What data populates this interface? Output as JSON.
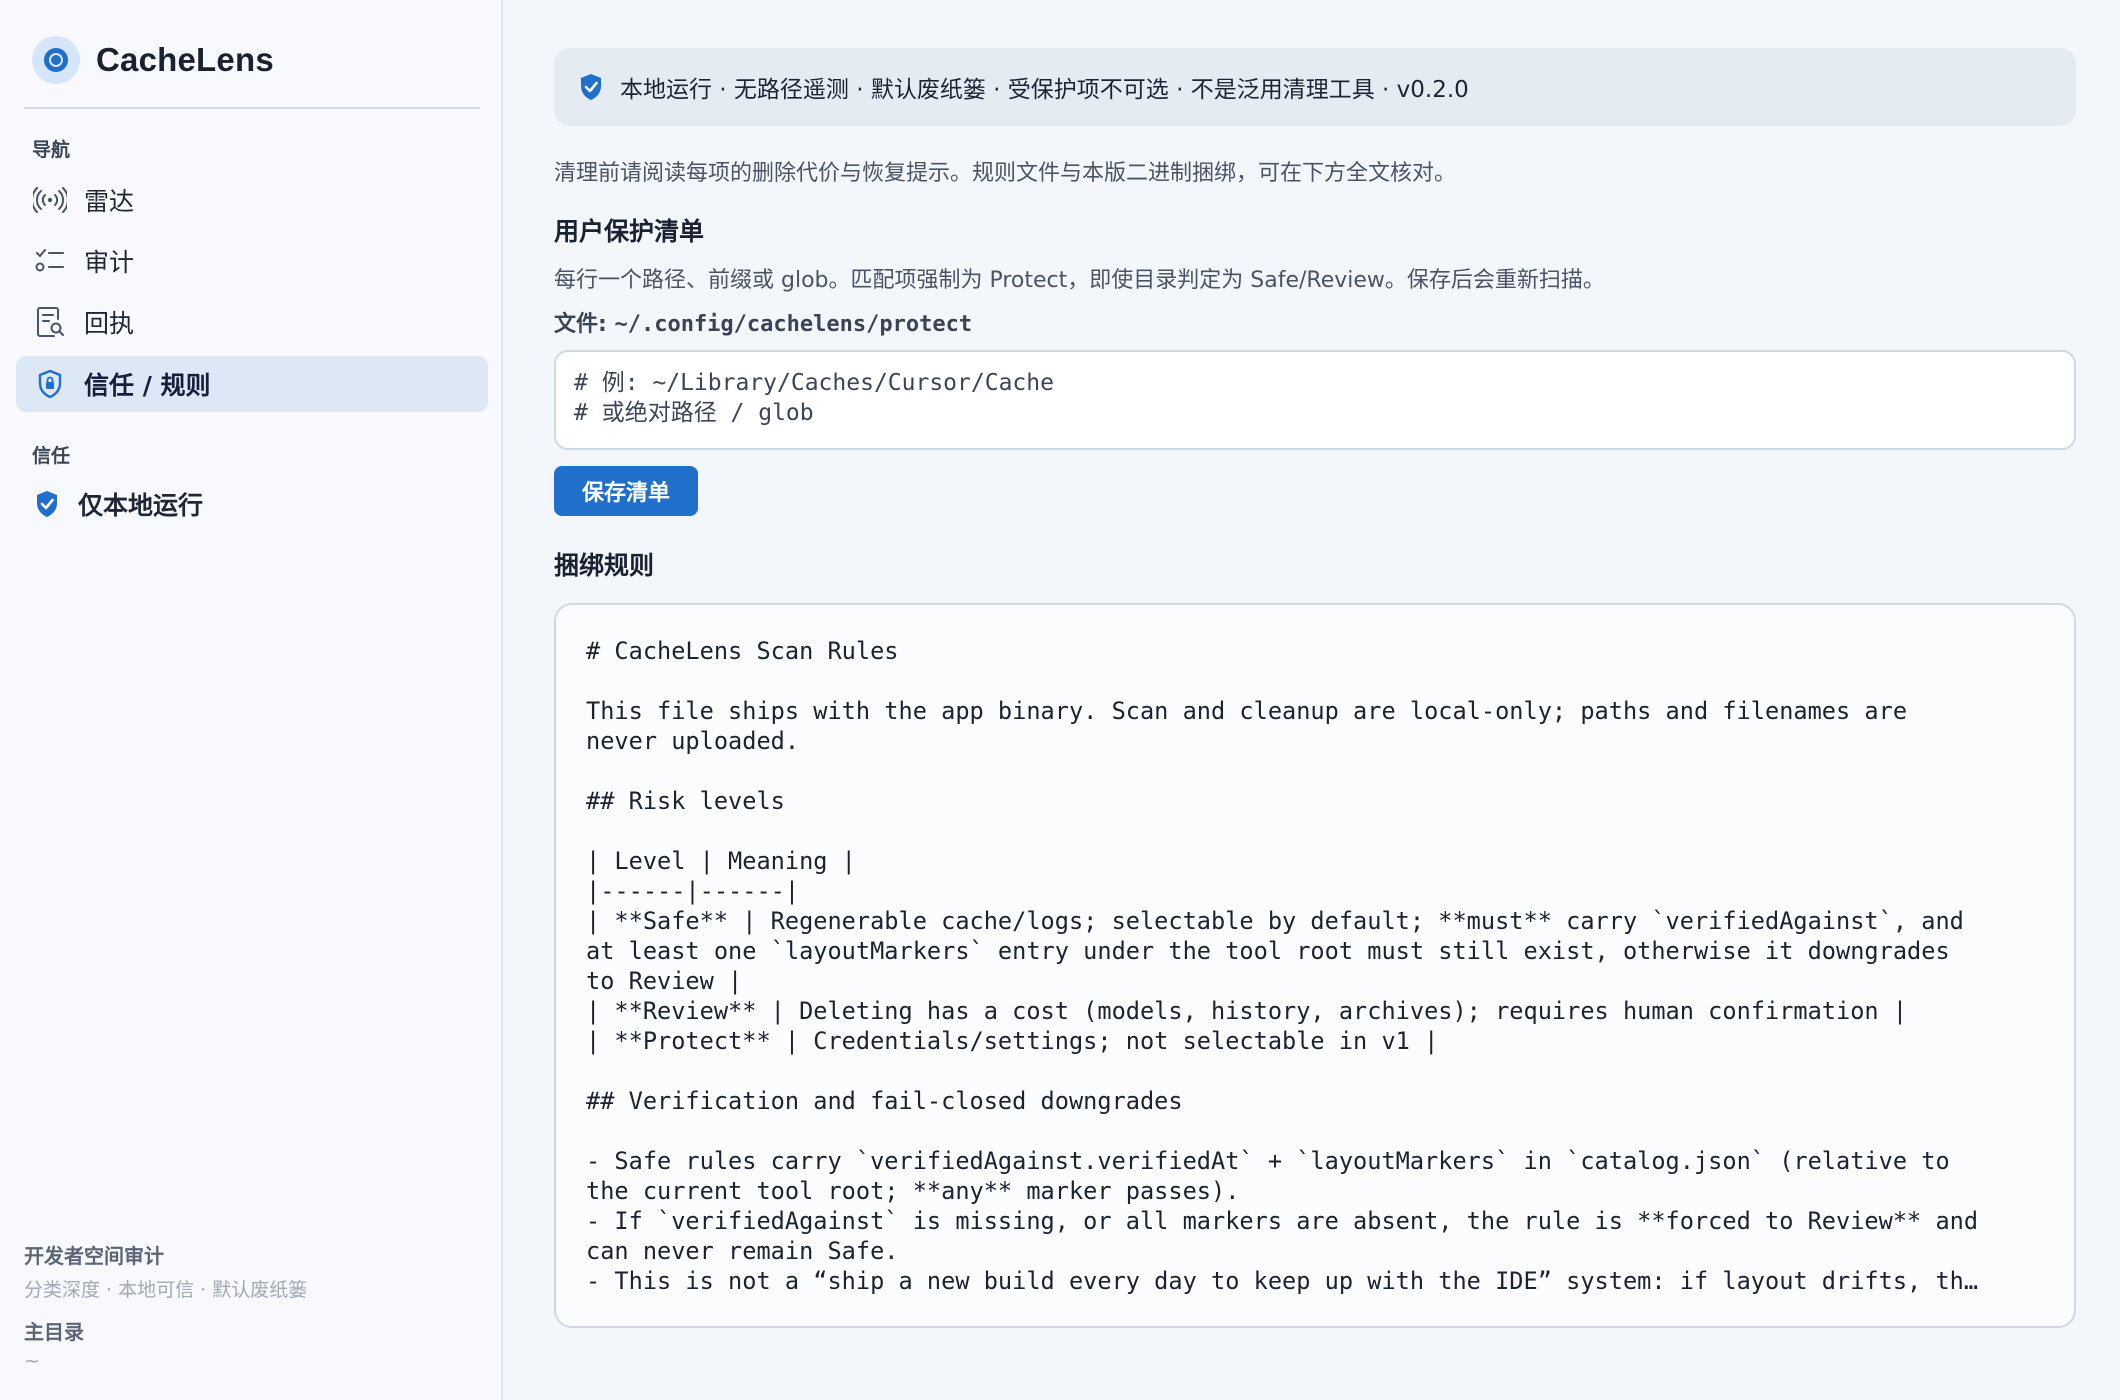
{
  "app": {
    "name": "CacheLens"
  },
  "sidebar": {
    "nav_section_label": "导航",
    "nav_items": [
      {
        "label": "雷达",
        "icon": "radar-icon"
      },
      {
        "label": "审计",
        "icon": "audit-list-icon"
      },
      {
        "label": "回执",
        "icon": "receipt-icon"
      },
      {
        "label": "信任 / 规则",
        "icon": "shield-lock-icon",
        "active": true
      }
    ],
    "trust_section_label": "信任",
    "trust_items": [
      {
        "label": "仅本地运行",
        "icon": "shield-check-icon"
      }
    ],
    "footer": {
      "title": "开发者空间审计",
      "subtitle": "分类深度 · 本地可信 · 默认废纸篓",
      "home_label": "主目录",
      "home_value": "~"
    }
  },
  "main": {
    "banner": {
      "icon": "shield-check-icon",
      "text": "本地运行 · 无路径遥测 · 默认废纸篓 · 受保护项不可选 · 不是泛用清理工具 · v0.2.0"
    },
    "intro": "清理前请阅读每项的删除代价与恢复提示。规则文件与本版二进制捆绑，可在下方全文核对。",
    "protect_list": {
      "heading": "用户保护清单",
      "description": "每行一个路径、前缀或 glob。匹配项强制为 Protect，即使目录判定为 Safe/Review。保存后会重新扫描。",
      "file_label": "文件: ",
      "file_path": "~/.config/cachelens/protect",
      "placeholder": "# 例: ~/Library/Caches/Cursor/Cache\n# 或绝对路径 / glob",
      "save_label": "保存清单"
    },
    "bundled_rules": {
      "heading": "捆绑规则",
      "lines": [
        "# CacheLens Scan Rules",
        "",
        "This file ships with the app binary. Scan and cleanup are local-only; paths and filenames are",
        "never uploaded.",
        "",
        "## Risk levels",
        "",
        "| Level | Meaning |",
        "|------|------|",
        "| **Safe** | Regenerable cache/logs; selectable by default; **must** carry `verifiedAgainst`, and",
        "at least one `layoutMarkers` entry under the tool root must still exist, otherwise it downgrades",
        "to Review |",
        "| **Review** | Deleting has a cost (models, history, archives); requires human confirmation |",
        "| **Protect** | Credentials/settings; not selectable in v1 |",
        "",
        "## Verification and fail-closed downgrades",
        "",
        "- Safe rules carry `verifiedAgainst.verifiedAt` + `layoutMarkers` in `catalog.json` (relative to",
        "the current tool root; **any** marker passes).",
        "- If `verifiedAgainst` is missing, or all markers are absent, the rule is **forced to Review** and",
        "can never remain Safe.",
        "- This is not a “ship a new build every day to keep up with the IDE” system: if layout drifts, th…"
      ]
    }
  },
  "colors": {
    "accent": "#1f6fcb",
    "active_nav_bg": "#dce8f6",
    "banner_bg": "#e5ebf3",
    "page_bg": "#f3f6fb"
  }
}
